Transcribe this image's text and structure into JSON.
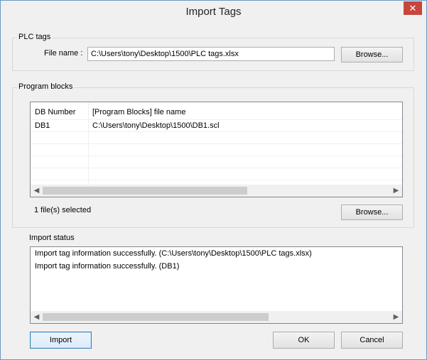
{
  "window": {
    "title": "Import Tags"
  },
  "icons": {
    "close": "close-icon",
    "scroll_left": "scroll-left-icon",
    "scroll_right": "scroll-right-icon"
  },
  "plc_tags": {
    "group_label": "PLC tags",
    "file_name_label": "File name :",
    "file_name_value": "C:\\Users\\tony\\Desktop\\1500\\PLC tags.xlsx",
    "browse_label": "Browse..."
  },
  "program_blocks": {
    "group_label": "Program blocks",
    "columns": [
      "DB Number",
      "[Program Blocks] file name"
    ],
    "rows": [
      {
        "db": "DB1",
        "file": "C:\\Users\\tony\\Desktop\\1500\\DB1.scl"
      }
    ],
    "selected_text": "1 file(s) selected",
    "browse_label": "Browse..."
  },
  "import_status": {
    "group_label": "Import status",
    "lines": [
      "Import tag information successfully. (C:\\Users\\tony\\Desktop\\1500\\PLC tags.xlsx)",
      "Import tag information successfully. (DB1)"
    ]
  },
  "buttons": {
    "import": "Import",
    "ok": "OK",
    "cancel": "Cancel"
  }
}
